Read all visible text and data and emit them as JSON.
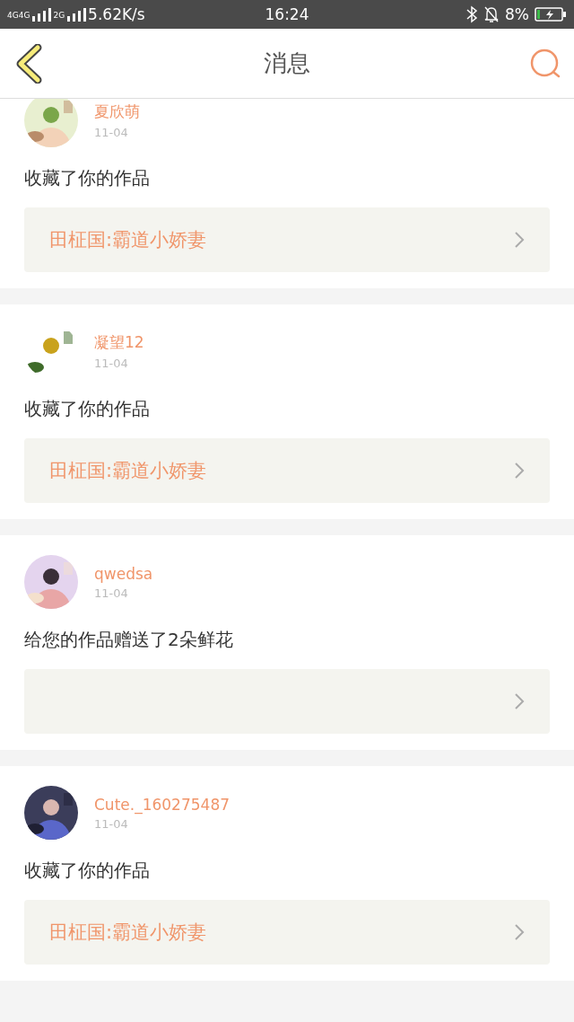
{
  "status_bar": {
    "sim_1": "4G4G",
    "sim_2": "2G",
    "network": "5.62K/s",
    "time": "16:24",
    "battery": "8%"
  },
  "nav": {
    "title": "消息"
  },
  "messages": [
    {
      "name": "夏欣萌",
      "date": "11-04",
      "action": "收藏了你的作品",
      "work": "田柾国:霸道小娇妻"
    },
    {
      "name": "凝望12",
      "date": "11-04",
      "action": "收藏了你的作品",
      "work": "田柾国:霸道小娇妻"
    },
    {
      "name": "qwedsa",
      "date": "11-04",
      "action": "给您的作品赠送了2朵鲜花"
    },
    {
      "name": "Cute._160275487",
      "date": "11-04",
      "action": "收藏了你的作品",
      "work": "田柾国:霸道小娇妻"
    }
  ]
}
